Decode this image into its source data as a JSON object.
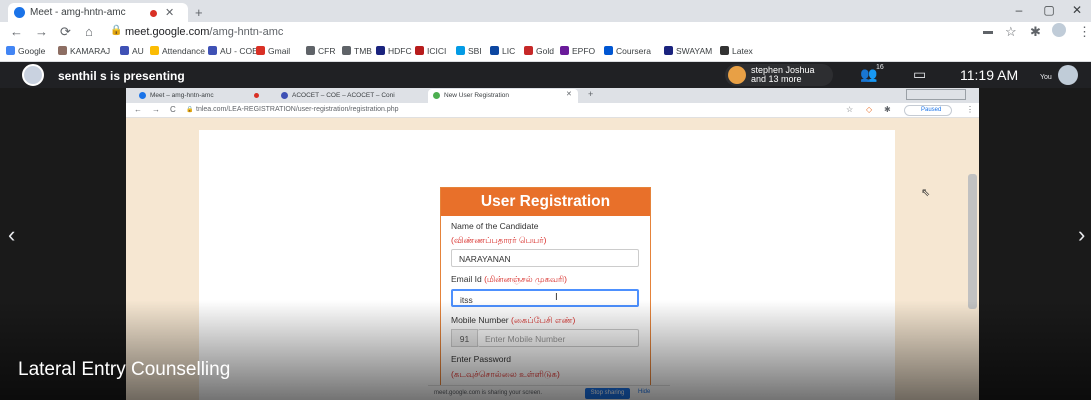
{
  "outer_browser": {
    "tab_title": "Meet - amg-hntn-amc",
    "new_tab": "+",
    "url_host": "meet.google.com",
    "url_path": "/amg-hntn-amc",
    "window_controls": [
      "–",
      "▢",
      "✕"
    ],
    "bookmarks": [
      {
        "label": "Google",
        "color": "#4285f4"
      },
      {
        "label": "KAMARAJ",
        "color": "#8d6e63"
      },
      {
        "label": "AU",
        "color": "#3f51b5"
      },
      {
        "label": "Attendance",
        "color": "#fbbc04"
      },
      {
        "label": "AU - COE",
        "color": "#3f51b5"
      },
      {
        "label": "Gmail",
        "color": "#d93025"
      },
      {
        "label": "CFR",
        "color": "#5f6368"
      },
      {
        "label": "TMB",
        "color": "#5f6368"
      },
      {
        "label": "HDFC",
        "color": "#1a237e"
      },
      {
        "label": "ICICI",
        "color": "#b71c1c"
      },
      {
        "label": "SBI",
        "color": "#039be5"
      },
      {
        "label": "LIC",
        "color": "#0d47a1"
      },
      {
        "label": "Gold",
        "color": "#c62828"
      },
      {
        "label": "EPFO",
        "color": "#6a1b9a"
      },
      {
        "label": "Coursera",
        "color": "#0056d2"
      },
      {
        "label": "SWAYAM",
        "color": "#1a237e"
      },
      {
        "label": "Latex",
        "color": "#333333"
      }
    ]
  },
  "meet": {
    "presenting_text": "senthil s is presenting",
    "participant_name": "stephen Joshua",
    "participant_more": "and 13 more",
    "participants_count": "16",
    "time": "11:19 AM",
    "you_label": "You"
  },
  "inner_browser": {
    "tabs": [
      {
        "label": "Meet – amg-hntn-amc",
        "active": false
      },
      {
        "label": "ACOCET – COE – ACOCET – Coni",
        "active": false
      },
      {
        "label": "New User Registration",
        "active": true
      }
    ],
    "url": "tnlea.com/LEA-REGISTRATION/user-registration/registration.php",
    "paused_label": "Paused"
  },
  "form": {
    "title": "User Registration",
    "name_label": "Name of the Candidate",
    "name_label_ta": "(விண்ணப்பதாரர் பெயர்)",
    "name_value": "NARAYANAN",
    "email_label": "Email Id",
    "email_label_ta": "(மின்னஞ்சல் முகவரி)",
    "email_value": "itss",
    "mobile_label": "Mobile Number",
    "mobile_label_ta": "(கைப்பேசி எண்)",
    "mobile_prefix": "91",
    "mobile_placeholder": "Enter Mobile Number",
    "password_label": "Enter Password",
    "password_label_ta": "(கடவுச்சொல்லை உள்ளிடுக)"
  },
  "share_bar": {
    "text": "meet.google.com is sharing your screen.",
    "stop_label": "Stop sharing",
    "hide_label": "Hide"
  },
  "caption": "Lateral Entry Counselling",
  "colors": {
    "accent_orange": "#e8702a",
    "tamil_red": "#d9302c",
    "focus_blue": "#4d90fe"
  }
}
